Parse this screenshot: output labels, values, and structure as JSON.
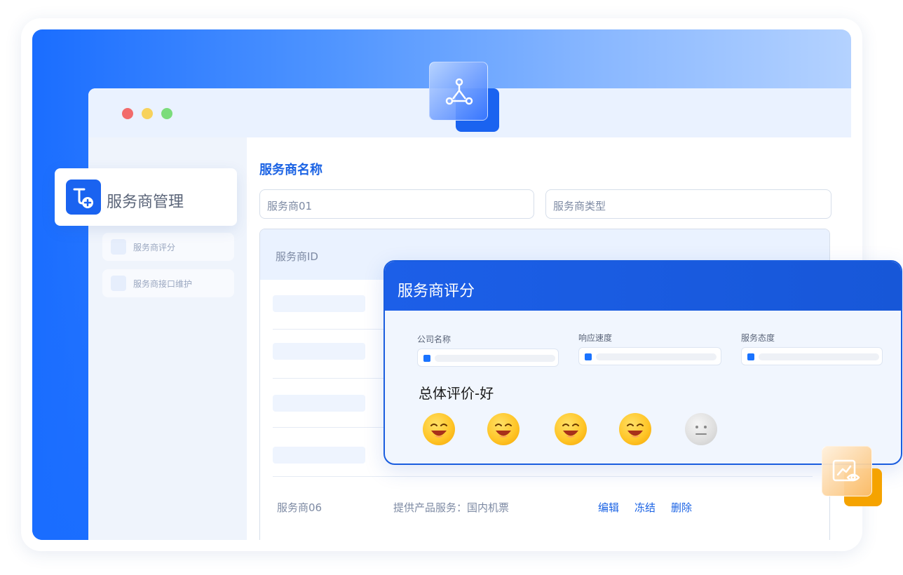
{
  "window": {
    "dots": [
      "#f26b6b",
      "#f7d25c",
      "#7bdc7b"
    ]
  },
  "sidebar": {
    "header_label": "服务商管理",
    "items": [
      {
        "label": "服务商评分"
      },
      {
        "label": "服务商接口维护"
      }
    ]
  },
  "main": {
    "section_title": "服务商名称",
    "name_input": "服务商01",
    "type_input": "服务商类型",
    "table": {
      "header": "服务商ID",
      "row": {
        "name": "服务商06",
        "service": "提供产品服务：国内机票",
        "actions": [
          "编辑",
          "冻结",
          "删除"
        ]
      }
    }
  },
  "rating_panel": {
    "title": "服务商评分",
    "metrics": [
      {
        "label": "公司名称"
      },
      {
        "label": "响应速度"
      },
      {
        "label": "服务态度"
      }
    ],
    "overall": "总体评价-好",
    "rating_value": 4,
    "rating_max": 5
  },
  "colors": {
    "primary": "#1b63e4",
    "accent_orange": "#f5a300"
  },
  "icons": {
    "hero": "network-nodes-icon",
    "sidebar": "service-add-icon",
    "float": "chart-eye-icon"
  }
}
